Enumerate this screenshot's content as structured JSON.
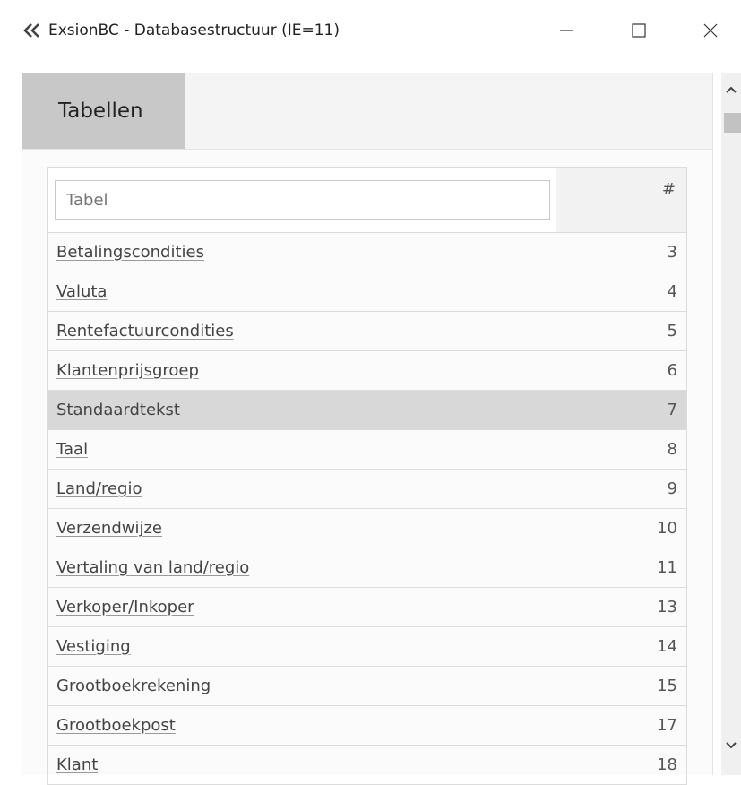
{
  "window": {
    "title": "ExsionBC - Databasestructuur (IE=11)",
    "icon": "double-chevron-left-icon"
  },
  "tabs": [
    {
      "label": "Tabellen",
      "active": true
    }
  ],
  "table": {
    "filter_placeholder": "Tabel",
    "num_header": "#",
    "rows": [
      {
        "name": "Betalingscondities",
        "id": "3"
      },
      {
        "name": "Valuta",
        "id": "4"
      },
      {
        "name": "Rentefactuurcondities",
        "id": "5"
      },
      {
        "name": "Klantenprijsgroep",
        "id": "6"
      },
      {
        "name": "Standaardtekst",
        "id": "7"
      },
      {
        "name": "Taal",
        "id": "8"
      },
      {
        "name": "Land/regio",
        "id": "9"
      },
      {
        "name": "Verzendwijze",
        "id": "10"
      },
      {
        "name": "Vertaling van land/regio",
        "id": "11"
      },
      {
        "name": "Verkoper/Inkoper",
        "id": "13"
      },
      {
        "name": "Vestiging",
        "id": "14"
      },
      {
        "name": "Grootboekrekening",
        "id": "15"
      },
      {
        "name": "Grootboekpost",
        "id": "17"
      },
      {
        "name": "Klant",
        "id": "18"
      }
    ],
    "selected_row": "Standaardtekst"
  },
  "colors": {
    "tab_active": "#c8c8c8",
    "row_selected": "#d8d8d8",
    "border": "#dcdcdc"
  }
}
